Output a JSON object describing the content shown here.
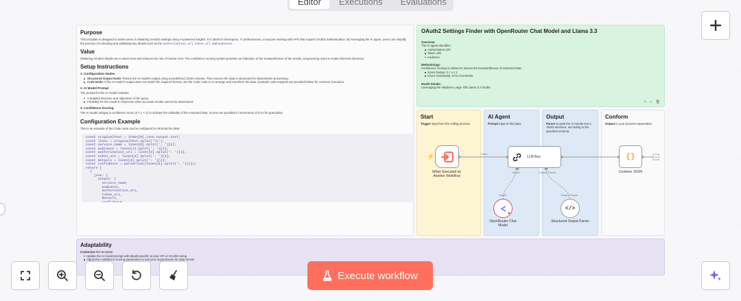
{
  "tabs": [
    "Editor",
    "Executions",
    "Evaluations"
  ],
  "left_note": {
    "purpose_title": "Purpose",
    "purpose_text": "This template is designed to assist users in obtaining OAuth2 settings using AI-powered insights. It is ideal for developers, IT professionals, or anyone working with APIs that require OAuth2 authentication. By leveraging the AI agent, users can simplify the process of extracting and validating key details such as the",
    "purpose_codes": [
      "authorization_url",
      "token_url",
      "audience"
    ],
    "purpose_and": ", ",
    "purpose_end": ", and ",
    "value_title": "Value",
    "value_text": "Obtaining OAuth2 details via AI saves time and reduces the risk of human error. The confidence scoring system provides an indication of the trustworthiness of the results, empowering users to make informed decisions.",
    "setup_title": "Setup Instructions",
    "setup_1": "1. Configuration Nodes",
    "setup_1_items": [
      {
        "b": "Structured Output Node:",
        "t": " Parses the AI model's output using a predefined JSON schema. This ensures the data is structured for downstream processing."
      },
      {
        "b": "Code Node:",
        "t": " If the AI model's output does not match the required format, use the Code node to re-arrange and transform the data. Example code snippets are provided below for common scenarios."
      }
    ],
    "setup_2": "2. AI Model Prompt",
    "setup_2_text": "The prompt for the AI model includes:",
    "setup_2_items": [
      "A detailed structure and objectives of the query.",
      "Flexibility for the model to improvise when accurate results cannot be determined."
    ],
    "setup_3": "3. Confidence Scoring",
    "setup_3_text": "The AI model assigns a confidence score (0 < x < 1) to indicate the reliability of the extracted data. Scores are provided in increments of 0.01 for granularity.",
    "config_title": "Configuration Example",
    "config_text": "This is an example of the Code node can be configured to reformat the data:",
    "code": "const originalText = items[0].json.output.text;\nconst lines = originalText.split('\\n');\nconst service_name = lines[0].split(': ')[1];\nconst audience = lines[1].split(': ')[1];\nconst authorization_uri = lines[2].split(': ')[1];\nconst token_uri = lines[3].split(': ')[1];\nconst details = lines[4].split(': ')[1];\nconst confidence = parseFloat(lines[5].split(': ')[1]);\nreturn [\n  {\n    json: {\n      output: {\n        service_name,\n        audience,\n        authorization_uri,\n        token_uri,\n        details,\n        confidence\n      }\n    }\n  }\n];"
  },
  "top_note": {
    "title": "OAuth2 Settings Finder with OpenRouter Chat Model and Llama 3.3",
    "overview_label": "Overview:",
    "overview_text": "The AI agent identifies:",
    "overview_items": [
      "Authorization URI",
      "Token URI",
      "Audience"
    ],
    "method_label": "Methodology:",
    "method_text": "Confidence scoring is utilized to assess the trustworthiness of extracted data:",
    "method_items": [
      "Score Range: 0 < x ≤ 1",
      "Score Granularity: 0.01 increments"
    ],
    "model_label": "Model Details:",
    "model_text": "Leveraging the Wayfarer Large 70b Llama 3.3 model."
  },
  "sections": {
    "start": {
      "title": "Start",
      "bold": "Trigger",
      "text": " input from the calling process."
    },
    "agent": {
      "title": "AI Agent",
      "bold": "Prompt",
      "text": " input to find data."
    },
    "output": {
      "title": "Output",
      "bold": "Parser",
      "text": " to grab the AI results into a JSON structure, according to the specified schema."
    },
    "conform": {
      "title": "Conform",
      "bold": "Output",
      "text": " to your process expectation."
    }
  },
  "nodes": {
    "trigger": "When Executed by Another Workflow",
    "llm": "LLM Bus",
    "conform": "Conform JSON",
    "chat_model": "OpenRouter Chat Model",
    "parser": "Structured Output Parser",
    "edge_label": "1 item",
    "model_port": "Model",
    "parser_port": "Output Parser"
  },
  "adapt_note": {
    "title": "Adaptability",
    "bold": "Customize",
    "text": " this template:",
    "items": [
      "Update the AI model prompt with details specific to your API or OAuth2 setup.",
      "Adjust the confidence scoring parameters to suit your requirements for data format."
    ]
  },
  "buttons": {
    "execute": "Execute workflow"
  },
  "colors": {
    "execute_bg": "#ff6f5c",
    "trigger_accent": "#ff6d5a",
    "conform_accent": "#f5a623",
    "agent_accent": "#7b61ff"
  }
}
